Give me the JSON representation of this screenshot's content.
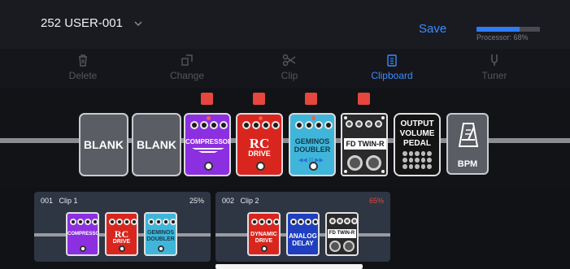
{
  "header": {
    "preset_name": "252 USER-001",
    "save_label": "Save",
    "processor_label": "Processor: 68%",
    "processor_fraction": 0.68
  },
  "toolbar": {
    "items": [
      {
        "label": "Delete",
        "icon": "trash-icon",
        "state": "disabled"
      },
      {
        "label": "Change",
        "icon": "swap-icon",
        "state": "disabled"
      },
      {
        "label": "Clip",
        "icon": "scissors-icon",
        "state": "disabled"
      },
      {
        "label": "Clipboard",
        "icon": "clipboard-icon",
        "state": "active"
      },
      {
        "label": "Tuner",
        "icon": "tuning-fork-icon",
        "state": "disabled"
      }
    ]
  },
  "chain": {
    "slots": [
      {
        "type": "blank",
        "label": "BLANK"
      },
      {
        "type": "blank",
        "label": "BLANK"
      },
      {
        "type": "pedal",
        "label": "COMPRESSOR",
        "color": "#8c2fe0",
        "selected": true
      },
      {
        "type": "pedal",
        "label": "RC DRIVE",
        "line1": "RC",
        "line2": "DRIVE",
        "color": "#d8261f",
        "selected": true
      },
      {
        "type": "pedal",
        "label": "GEMINOS DOUBLER",
        "line1": "GEMINOS",
        "line2": "DOUBLER",
        "color": "#3fb6d9",
        "selected": true
      },
      {
        "type": "amp",
        "label": "FD TWIN-R",
        "selected": true
      },
      {
        "type": "volume",
        "label": "OUTPUT VOLUME PEDAL",
        "line1": "OUTPUT",
        "line2": "VOLUME",
        "line3": "PEDAL"
      },
      {
        "type": "bpm",
        "label": "BPM",
        "icon": "metronome-icon"
      }
    ]
  },
  "clips": [
    {
      "id": "001",
      "name": "Clip 1",
      "percent": "25%",
      "percent_color": "#e6e6ea",
      "pedals": [
        {
          "label": "COMPRESSOR",
          "color": "#8c2fe0"
        },
        {
          "label": "RC DRIVE",
          "line1": "RC",
          "line2": "DRIVE",
          "color": "#d8261f"
        },
        {
          "label": "GEMINOS DOUBLER",
          "line1": "GEMINOS",
          "line2": "DOUBLER",
          "color": "#3fb6d9"
        }
      ]
    },
    {
      "id": "002",
      "name": "Clip 2",
      "percent": "65%",
      "percent_color": "#e5473f",
      "pedals": [
        {
          "label": "DYNAMIC DRIVE",
          "line1": "DYNAMIC",
          "line2": "DRIVE",
          "color": "#d8261f"
        },
        {
          "label": "ANALOG DELAY",
          "line1": "ANALOG",
          "line2": "DELAY",
          "color": "#1f3fbf"
        },
        {
          "label": "FD TWIN-R",
          "color": "#2a2a2c"
        }
      ]
    }
  ]
}
